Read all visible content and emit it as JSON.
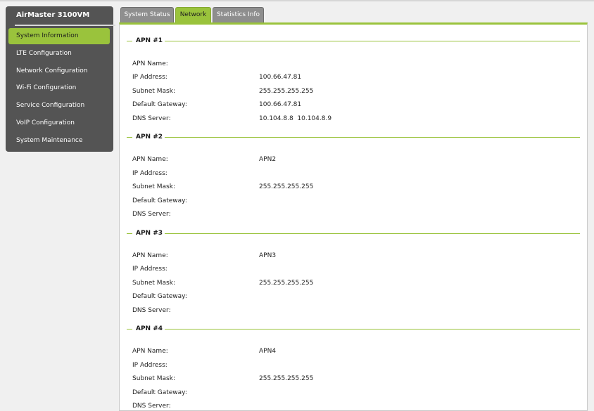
{
  "sidebar": {
    "brand": "AirMaster 3100VM",
    "items": [
      {
        "label": "System Information"
      },
      {
        "label": "LTE Configuration"
      },
      {
        "label": "Network Configuration"
      },
      {
        "label": "Wi-Fi Configuration"
      },
      {
        "label": "Service Configuration"
      },
      {
        "label": "VoIP Configuration"
      },
      {
        "label": "System Maintenance"
      }
    ]
  },
  "tabs": [
    {
      "label": "System Status"
    },
    {
      "label": "Network"
    },
    {
      "label": "Statistics Info"
    }
  ],
  "labels": {
    "apn_name": "APN Name:",
    "ip_address": "IP Address:",
    "subnet_mask": "Subnet Mask:",
    "default_gateway": "Default Gateway:",
    "dns_server": "DNS Server:"
  },
  "apns": [
    {
      "title": "APN #1",
      "apn_name": "",
      "ip_address": "100.66.47.81",
      "subnet_mask": "255.255.255.255",
      "default_gateway": "100.66.47.81",
      "dns_server": "10.104.8.8  10.104.8.9"
    },
    {
      "title": "APN #2",
      "apn_name": "APN2",
      "ip_address": "",
      "subnet_mask": "255.255.255.255",
      "default_gateway": "",
      "dns_server": ""
    },
    {
      "title": "APN #3",
      "apn_name": "APN3",
      "ip_address": "",
      "subnet_mask": "255.255.255.255",
      "default_gateway": "",
      "dns_server": ""
    },
    {
      "title": "APN #4",
      "apn_name": "APN4",
      "ip_address": "",
      "subnet_mask": "255.255.255.255",
      "default_gateway": "",
      "dns_server": ""
    }
  ],
  "colors": {
    "accent": "#9ac33c",
    "sidebar_bg": "#545454",
    "tab_inactive": "#8e8e8e"
  }
}
